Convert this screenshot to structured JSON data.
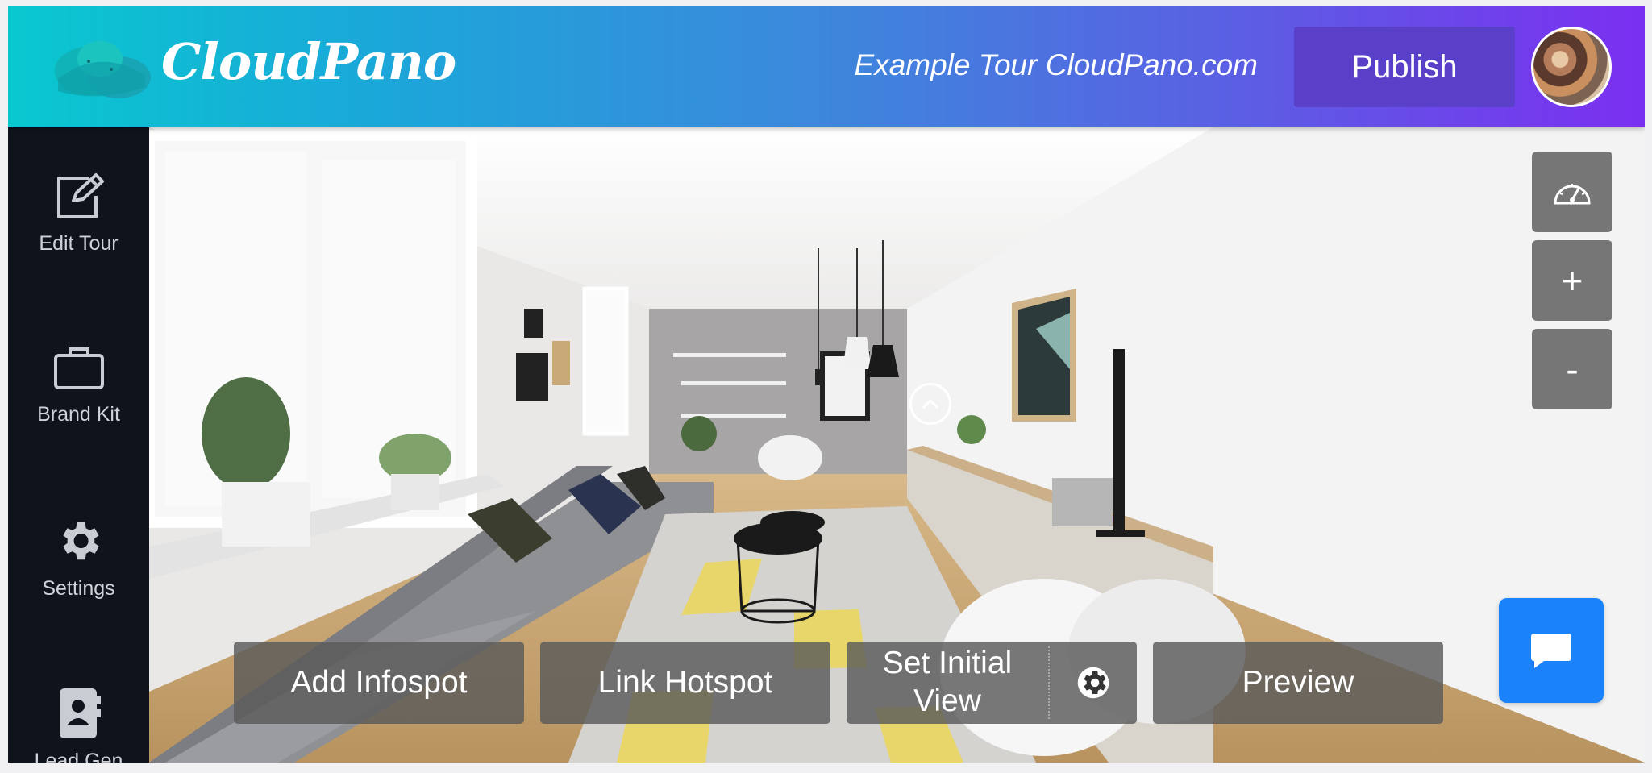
{
  "header": {
    "brand": "CloudPano",
    "tour_title": "Example Tour CloudPano.com",
    "publish_label": "Publish"
  },
  "sidebar": {
    "items": [
      {
        "label": "Edit Tour",
        "icon": "edit-icon"
      },
      {
        "label": "Brand Kit",
        "icon": "briefcase-icon"
      },
      {
        "label": "Settings",
        "icon": "gear-icon"
      },
      {
        "label": "Lead Gen",
        "icon": "contact-book-icon"
      }
    ]
  },
  "controls": {
    "speed_icon": "speedometer-icon",
    "zoom_in_label": "+",
    "zoom_out_label": "-"
  },
  "toolbar": {
    "add_infospot": "Add Infospot",
    "link_hotspot": "Link Hotspot",
    "set_initial_view_line1": "Set Initial",
    "set_initial_view_line2": "View",
    "preview": "Preview"
  },
  "colors": {
    "header_gradient_start": "#09c8cf",
    "header_gradient_end": "#7b2ff0",
    "publish_bg": "#5a3fc8",
    "sidebar_bg": "#0f131c",
    "chat_button": "#1a82fb",
    "control_bg": "#767676"
  }
}
